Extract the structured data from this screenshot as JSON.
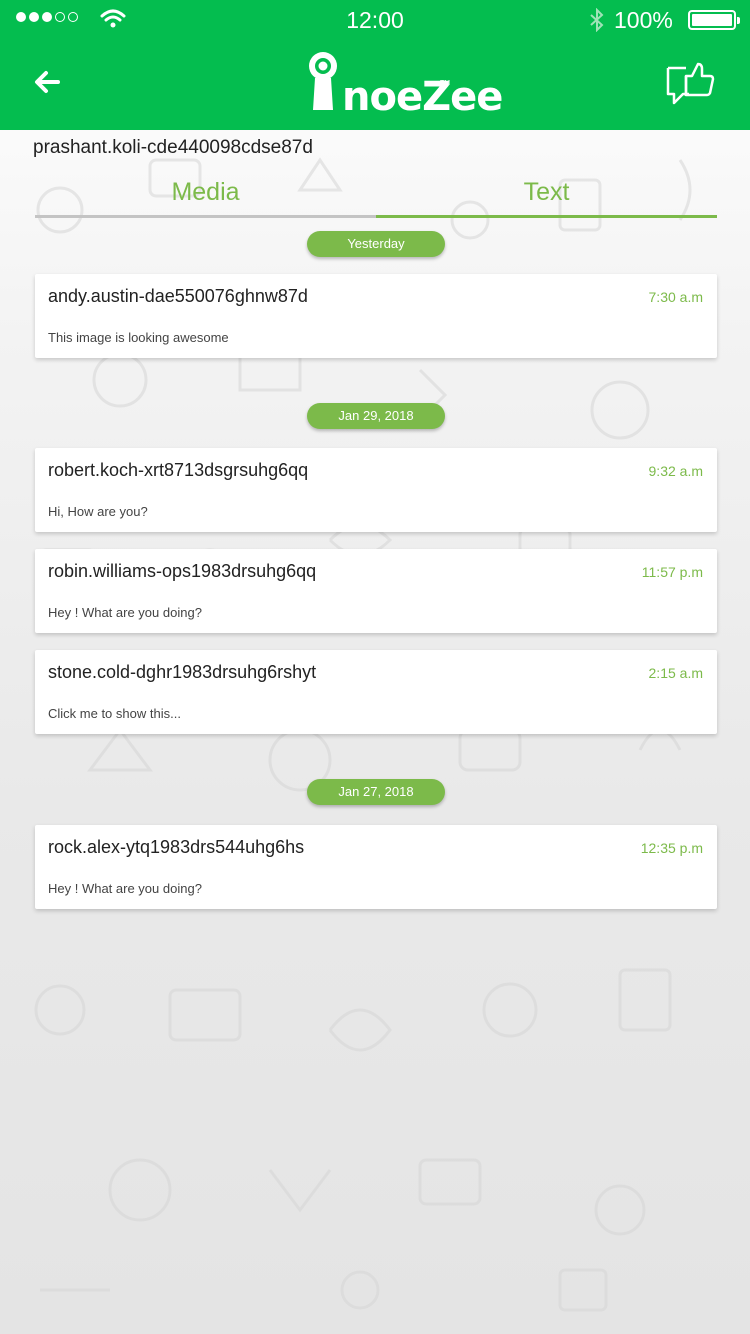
{
  "status_bar": {
    "time": "12:00",
    "battery": "100%",
    "icons": [
      "signal-dots-icon",
      "wifi-icon",
      "bluetooth-icon",
      "battery-icon"
    ]
  },
  "header": {
    "back_icon": "arrow-left-icon",
    "logo_text": "noeZee",
    "logo_tm": "TM",
    "feedback_icon": "thumbs-up-chat-icon",
    "color": "#04bd4f"
  },
  "user_id": "prashant.koli-cde440098cdse87d",
  "tabs": [
    {
      "label": "Media",
      "active": false
    },
    {
      "label": "Text",
      "active": true
    }
  ],
  "accent_color": "#7cba4a",
  "groups": [
    {
      "date": "Yesterday",
      "messages": [
        {
          "name": "andy.austin-dae550076ghnw87d",
          "time": "7:30 a.m",
          "text": "This image is looking awesome"
        }
      ]
    },
    {
      "date": "Jan 29, 2018",
      "messages": [
        {
          "name": "robert.koch-xrt8713dsgrsuhg6qq",
          "time": "9:32 a.m",
          "text": "Hi, How are you?"
        },
        {
          "name": "robin.williams-ops1983drsuhg6qq",
          "time": "11:57 p.m",
          "text": "Hey ! What are you doing?"
        },
        {
          "name": "stone.cold-dghr1983drsuhg6rshyt",
          "time": "2:15 a.m",
          "text": "Click me to show this..."
        }
      ]
    },
    {
      "date": "Jan 27, 2018",
      "messages": [
        {
          "name": "rock.alex-ytq1983drs544uhg6hs",
          "time": "12:35 p.m",
          "text": "Hey ! What are you doing?"
        }
      ]
    }
  ]
}
